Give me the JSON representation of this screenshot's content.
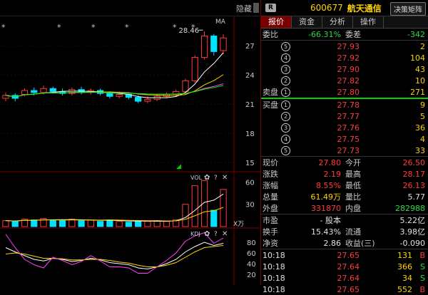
{
  "chart": {
    "hide_label": "隐藏",
    "ma_label": "MA",
    "high_mark": "28.46",
    "price_axis": [
      "27",
      "24",
      "21",
      "18",
      "15"
    ],
    "vol": {
      "label": "VOL",
      "axis": [
        "60",
        "30"
      ],
      "unit": "X万"
    },
    "kdj": {
      "label": "KDJ",
      "axis": [
        "80",
        "60",
        "40",
        "20"
      ]
    },
    "stars": [
      "*",
      "*",
      "*",
      "*",
      "*",
      "*"
    ],
    "candles": [
      {
        "o": 21.6,
        "c": 21.9,
        "h": 22.2,
        "l": 21.3,
        "v": 8
      },
      {
        "o": 21.9,
        "c": 21.6,
        "h": 22.1,
        "l": 21.3,
        "v": 7
      },
      {
        "o": 22.0,
        "c": 22.4,
        "h": 22.6,
        "l": 21.8,
        "v": 10
      },
      {
        "o": 22.4,
        "c": 22.2,
        "h": 22.7,
        "l": 21.9,
        "v": 9
      },
      {
        "o": 22.2,
        "c": 22.6,
        "h": 22.9,
        "l": 22.0,
        "v": 11
      },
      {
        "o": 22.6,
        "c": 22.3,
        "h": 22.8,
        "l": 22.1,
        "v": 9
      },
      {
        "o": 22.3,
        "c": 22.1,
        "h": 22.6,
        "l": 21.9,
        "v": 8
      },
      {
        "o": 22.1,
        "c": 22.5,
        "h": 22.7,
        "l": 21.9,
        "v": 10
      },
      {
        "o": 22.5,
        "c": 22.2,
        "h": 22.8,
        "l": 22.0,
        "v": 8
      },
      {
        "o": 22.2,
        "c": 22.4,
        "h": 22.6,
        "l": 22.0,
        "v": 9
      },
      {
        "o": 22.4,
        "c": 22.1,
        "h": 22.6,
        "l": 21.9,
        "v": 7
      },
      {
        "o": 22.1,
        "c": 21.8,
        "h": 22.3,
        "l": 21.6,
        "v": 9
      },
      {
        "o": 21.8,
        "c": 22.0,
        "h": 22.3,
        "l": 21.6,
        "v": 7
      },
      {
        "o": 22.0,
        "c": 21.7,
        "h": 22.2,
        "l": 21.5,
        "v": 6
      },
      {
        "o": 21.7,
        "c": 21.3,
        "h": 21.9,
        "l": 21.1,
        "v": 8
      },
      {
        "o": 21.3,
        "c": 21.5,
        "h": 21.8,
        "l": 21.1,
        "v": 7
      },
      {
        "o": 21.5,
        "c": 21.8,
        "h": 22.0,
        "l": 21.3,
        "v": 8
      },
      {
        "o": 21.8,
        "c": 22.0,
        "h": 22.2,
        "l": 21.6,
        "v": 7
      },
      {
        "o": 22.0,
        "c": 22.3,
        "h": 22.5,
        "l": 21.8,
        "v": 9
      },
      {
        "o": 22.3,
        "c": 23.4,
        "h": 23.6,
        "l": 22.2,
        "v": 30
      },
      {
        "o": 23.4,
        "c": 25.8,
        "h": 26.0,
        "l": 23.2,
        "v": 55
      },
      {
        "o": 25.8,
        "c": 28.0,
        "h": 28.46,
        "l": 25.6,
        "v": 62
      },
      {
        "o": 28.0,
        "c": 26.4,
        "h": 28.2,
        "l": 26.0,
        "v": 22
      },
      {
        "o": 26.5,
        "c": 27.8,
        "h": 28.17,
        "l": 26.13,
        "v": 50
      }
    ]
  },
  "header": {
    "badge": "R",
    "code": "600677",
    "name": "航天通信",
    "decision_button": "决策矩阵"
  },
  "tabs": [
    "报价",
    "资金",
    "分析",
    "操作"
  ],
  "order_book": {
    "weibi_label": "委比",
    "weibi_value": "-66.31%",
    "weicha_label": "委差",
    "weicha_value": "-342",
    "sell_label": "卖盘",
    "sells": [
      {
        "lvl": "5",
        "price": "27.93",
        "vol": "2"
      },
      {
        "lvl": "4",
        "price": "27.92",
        "vol": "104"
      },
      {
        "lvl": "3",
        "price": "27.90",
        "vol": "43"
      },
      {
        "lvl": "2",
        "price": "27.82",
        "vol": "10"
      },
      {
        "lvl": "1",
        "price": "27.80",
        "vol": "271"
      }
    ],
    "buy_label": "买盘",
    "buys": [
      {
        "lvl": "1",
        "price": "27.78",
        "vol": "9"
      },
      {
        "lvl": "2",
        "price": "27.77",
        "vol": "5"
      },
      {
        "lvl": "3",
        "price": "27.76",
        "vol": "36"
      },
      {
        "lvl": "4",
        "price": "27.75",
        "vol": "4"
      },
      {
        "lvl": "5",
        "price": "27.73",
        "vol": "33"
      }
    ]
  },
  "quote": [
    {
      "l1": "现价",
      "v1": "27.80",
      "c1": "red",
      "l2": "今开",
      "v2": "26.50",
      "c2": "red"
    },
    {
      "l1": "涨跌",
      "v1": "2.19",
      "c1": "red",
      "l2": "最高",
      "v2": "28.17",
      "c2": "red"
    },
    {
      "l1": "涨幅",
      "v1": "8.55%",
      "c1": "red",
      "l2": "最低",
      "v2": "26.13",
      "c2": "red"
    },
    {
      "l1": "总量",
      "v1": "61.49万",
      "c1": "yellow",
      "l2": "量比",
      "v2": "5.77",
      "c2": "white"
    },
    {
      "l1": "外盘",
      "v1": "331870",
      "c1": "red",
      "l2": "内盘",
      "v2": "282988",
      "c2": "green"
    }
  ],
  "finance": [
    {
      "l1": "市盈",
      "v1": "- 股本",
      "l2": "",
      "v2": "5.22亿"
    },
    {
      "l1": "换手",
      "v1": "15.43%",
      "l2": "流通",
      "v2": "3.98亿"
    },
    {
      "l1": "净资",
      "v1": "2.86",
      "l2": "收益(三)",
      "v2": "-0.090"
    }
  ],
  "ticks": [
    {
      "time": "10:18",
      "price": "27.65",
      "vol": "131",
      "side": "B"
    },
    {
      "time": "10:18",
      "price": "27.64",
      "vol": "366",
      "side": "S"
    },
    {
      "time": "10:18",
      "price": "27.64",
      "vol": "34",
      "side": "S"
    },
    {
      "time": "10:18",
      "price": "27.65",
      "vol": "552",
      "side": "B"
    }
  ],
  "colors": {
    "up": "#ff3b3b",
    "down": "#00e0ff",
    "ma1": "#ffffff",
    "ma2": "#ffd400",
    "ma3": "#ff40ff",
    "ma4": "#00ff00"
  }
}
